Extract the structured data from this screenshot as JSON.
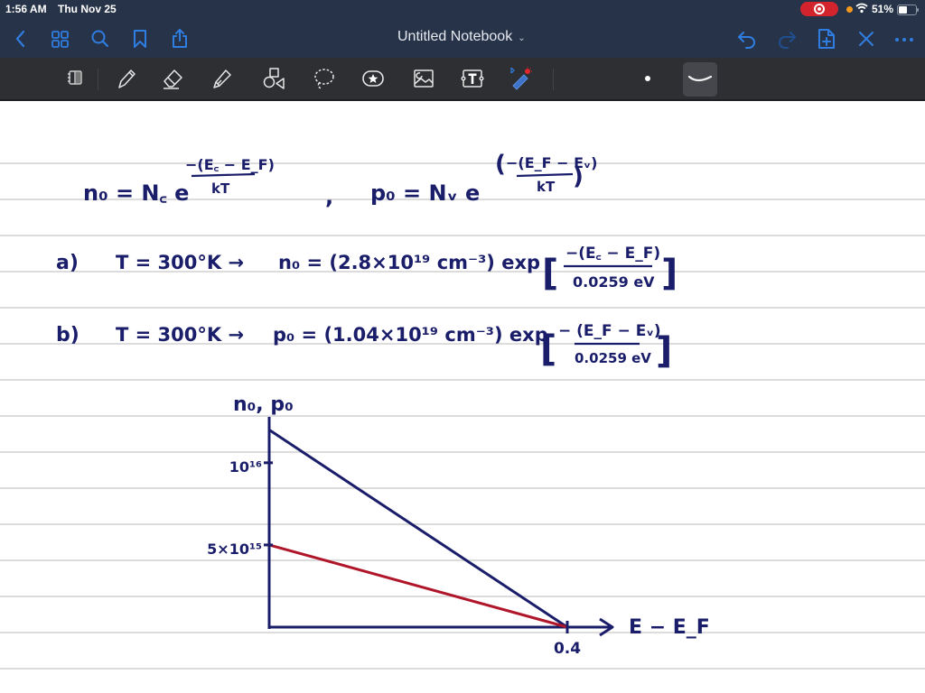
{
  "status_bar": {
    "time": "1:56 AM",
    "date": "Thu Nov 25",
    "battery_percent": "51%",
    "battery_level": 0.51,
    "recording": true
  },
  "nav_bar": {
    "title": "Untitled Notebook",
    "left_icons": [
      "back-icon",
      "thumbnails-grid-icon",
      "search-icon",
      "bookmark-icon",
      "share-icon"
    ],
    "right_icons": [
      "undo-icon",
      "redo-icon",
      "add-page-icon",
      "close-icon",
      "more-icon"
    ]
  },
  "toolbar": {
    "tools": [
      "page-view-icon",
      "pen-icon",
      "eraser-icon",
      "highlighter-icon",
      "shapes-icon",
      "lasso-icon",
      "sticker-icon",
      "image-icon",
      "text-box-icon",
      "laser-pointer-icon"
    ],
    "selected_tool": "pen-icon",
    "stroke_sizes": [
      "small-dot",
      "curve-stroke"
    ],
    "selected_stroke": "curve-stroke"
  },
  "notes": {
    "eq_n0_lhs": "n₀ = N꜀ e",
    "eq_n0_exp_num": "−(E꜀ − E_F)",
    "eq_n0_exp_den": "kT",
    "comma": ",",
    "eq_p0_lhs": "p₀ = Nᵥ e",
    "eq_p0_exp_num": "−(E_F − Eᵥ)",
    "eq_p0_exp_den": "kT",
    "part_a_label": "a)",
    "part_a_temp": "T = 300°K  →",
    "part_a_eq": "n₀ = (2.8×10¹⁹ cm⁻³) exp",
    "part_a_num": "−(E꜀ − E_F)",
    "part_a_den": "0.0259 eV",
    "part_b_label": "b)",
    "part_b_temp": "T = 300°K  →",
    "part_b_eq": "p₀ = (1.04×10¹⁹ cm⁻³) exp",
    "part_b_num": "− (E_F − Eᵥ)",
    "part_b_den": "0.0259 eV"
  },
  "chart_data": {
    "type": "line",
    "title": "",
    "xlabel": "E − E_F",
    "ylabel": "n₀, p₀",
    "x_ticks": [
      "0.4"
    ],
    "y_ticks": [
      "10¹⁶",
      "5×10¹⁵"
    ],
    "y_tick_values": [
      1e+16,
      5000000000000000.0
    ],
    "xlim": [
      0,
      0.4
    ],
    "ylim": [
      0,
      1.4e+16
    ],
    "series": [
      {
        "name": "n0 (blue)",
        "color": "#1a1d6a",
        "x": [
          0,
          0.4
        ],
        "y": [
          1.2e+16,
          0
        ]
      },
      {
        "name": "p0 (red)",
        "color": "#b0162a",
        "x": [
          0,
          0.4
        ],
        "y": [
          5000000000000000.0,
          0
        ]
      }
    ],
    "grid": false,
    "legend": "none"
  }
}
